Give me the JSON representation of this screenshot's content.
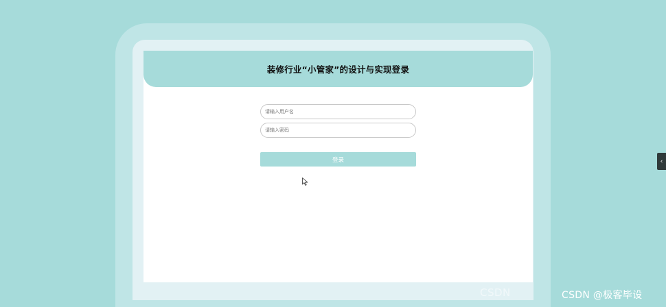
{
  "header": {
    "title": "装修行业“小管家”的设计与实现登录"
  },
  "form": {
    "username_placeholder": "请输入用户名",
    "username_value": "",
    "password_placeholder": "请输入密码",
    "password_value": "",
    "login_label": "登录"
  },
  "side_tab": {
    "glyph": "‹",
    "icon": "chevron-left-icon"
  },
  "watermark": {
    "faded_text": "CSDN",
    "text": "CSDN @极客毕设"
  },
  "colors": {
    "background": "#a6dbda",
    "frame": "#bfe5e6",
    "header": "#a6dbda",
    "button": "#a6dbda",
    "panel": "#ffffff"
  }
}
